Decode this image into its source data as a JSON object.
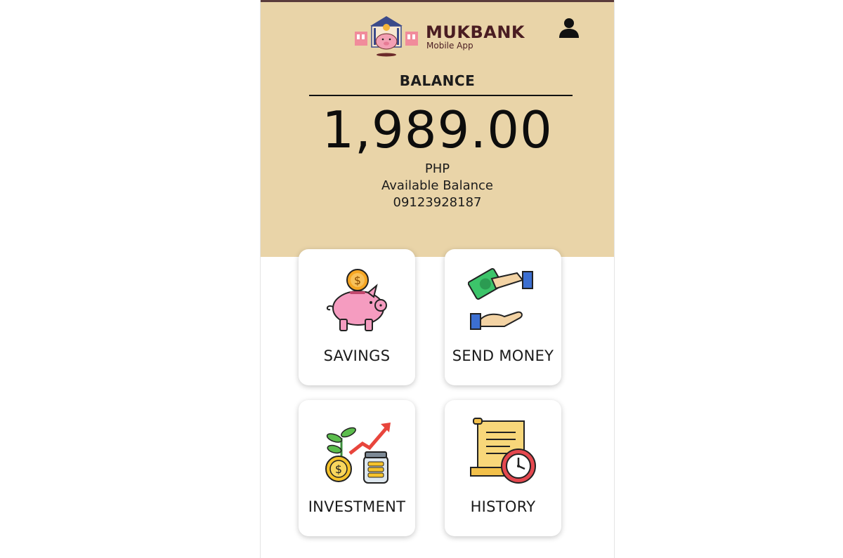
{
  "header": {
    "brand_name": "MUKBANK",
    "brand_sub": "Mobile App",
    "logo_icon": "bank-piggy-logo",
    "profile_icon": "user-icon"
  },
  "balance": {
    "label": "BALANCE",
    "amount": "1,989.00",
    "currency": "PHP",
    "caption": "Available Balance",
    "account_number": "09123928187"
  },
  "menu": [
    {
      "label": "SAVINGS",
      "icon": "piggy-bank-icon"
    },
    {
      "label": "SEND MONEY",
      "icon": "send-money-icon"
    },
    {
      "label": "INVESTMENT",
      "icon": "investment-icon"
    },
    {
      "label": "HISTORY",
      "icon": "history-icon"
    }
  ],
  "colors": {
    "header_bg": "#e9d4a8",
    "brand_text": "#4a1d22",
    "card_bg": "#ffffff"
  }
}
